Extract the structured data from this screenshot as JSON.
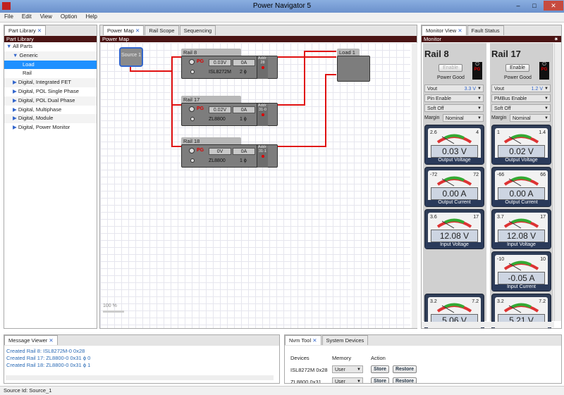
{
  "app": {
    "title": "Power Navigator 5",
    "min": "–",
    "max": "□",
    "close": "✕"
  },
  "menu": [
    "File",
    "Edit",
    "View",
    "Option",
    "Help"
  ],
  "part_library": {
    "tab": "Part Library",
    "header": "Part Library",
    "items": [
      "All Parts",
      "Generic",
      "Load",
      "Rail",
      "Digital, Integrated FET",
      "Digital, POL Single Phase",
      "Digital, POL Dual Phase",
      "Digital, Multiphase",
      "Digital, Module",
      "Digital, Power Monitor"
    ]
  },
  "center_tabs": [
    "Power Map",
    "Rail Scope",
    "Sequencing"
  ],
  "power_map": {
    "header": "Power Map",
    "zoom": "100 %",
    "source": "Source 1",
    "load": "Load 1",
    "rails": [
      {
        "name": "Rail 8",
        "v": "0.03V",
        "a": "0A",
        "chip": "ISL8272M",
        "phase": "2 ϕ",
        "addr_l": "Addr:",
        "addr": "28"
      },
      {
        "name": "Rail 17",
        "v": "0.02V",
        "a": "0A",
        "chip": "ZL8800",
        "phase": "1 ϕ",
        "addr_l": "Addr:",
        "addr": "31-0"
      },
      {
        "name": "Rail 18",
        "v": "0V",
        "a": "0A",
        "chip": "ZL8800",
        "phase": "1 ϕ",
        "addr_l": "Addr:",
        "addr": "31-1"
      }
    ],
    "pg": "PG"
  },
  "right_tabs": [
    "Monitor View",
    "Fault Status"
  ],
  "monitor": {
    "header": "Monitor",
    "cols": [
      {
        "title": "Rail 8",
        "enable": "Enable",
        "pg": "Power Good",
        "vout": "Vout",
        "vout_val": "3.3 V",
        "pin": "Pin Enable",
        "soft": "Soft Off",
        "margin": "Margin",
        "margin_val": "Nominal",
        "gauges": [
          {
            "min": "2.6",
            "max": "4",
            "val": "0.03 V",
            "lbl": "Output Voltage"
          },
          {
            "min": "-72",
            "max": "72",
            "val": "0.00 A",
            "lbl": "Output Current"
          },
          {
            "min": "3.6",
            "max": "17",
            "val": "12.08 V",
            "lbl": "Input Voltage"
          },
          {
            "min": "3.2",
            "max": "7.2",
            "val": "5.06 V",
            "lbl": ""
          }
        ]
      },
      {
        "title": "Rail 17",
        "enable": "Enable",
        "pg": "Power Good",
        "vout": "Vout",
        "vout_val": "1.2 V",
        "pin": "PMBus Enable",
        "soft": "Soft Off",
        "margin": "Margin",
        "margin_val": "Nominal",
        "gauges": [
          {
            "min": "1",
            "max": "1.4",
            "val": "0.02 V",
            "lbl": "Output Voltage"
          },
          {
            "min": "-66",
            "max": "66",
            "val": "0.00 A",
            "lbl": "Output Current"
          },
          {
            "min": "3.7",
            "max": "17",
            "val": "12.08 V",
            "lbl": "Input Voltage"
          },
          {
            "min": "-10",
            "max": "10",
            "val": "-0.05 A",
            "lbl": "Input Current"
          },
          {
            "min": "3.2",
            "max": "7.2",
            "val": "5.21 V",
            "lbl": ""
          }
        ]
      }
    ]
  },
  "messages": {
    "tab": "Message Viewer",
    "lines": [
      "Created Rail 8: ISL8272M-0 0x28",
      "Created Rail 17: ZL8800-0 0x31 ϕ 0",
      "Created Rail 18: ZL8800-0 0x31 ϕ 1"
    ]
  },
  "nvm": {
    "tabs": [
      "Nvm Tool",
      "System Devices"
    ],
    "h_dev": "Devices",
    "h_mem": "Memory",
    "h_act": "Action",
    "rows": [
      {
        "dev": "ISL8272M 0x28",
        "mem": "User",
        "store": "Store",
        "restore": "Restore"
      },
      {
        "dev": "ZL8800 0x31",
        "mem": "User",
        "store": "Store",
        "restore": "Restore"
      }
    ]
  },
  "status": "Source Id: Source_1",
  "colors": {
    "accent": "#1e90ff",
    "wire": "#e01010",
    "header": "#4a1414"
  }
}
